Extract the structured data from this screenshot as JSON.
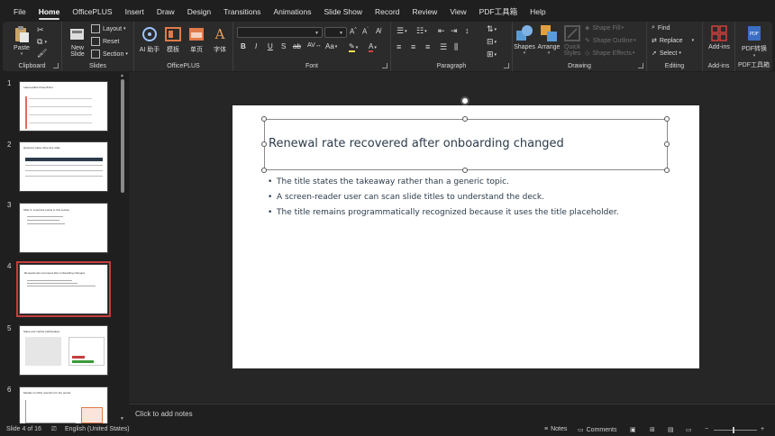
{
  "menu": [
    "File",
    "Home",
    "OfficePLUS",
    "Insert",
    "Draw",
    "Design",
    "Transitions",
    "Animations",
    "Slide Show",
    "Record",
    "Review",
    "View",
    "PDF工具箱",
    "Help"
  ],
  "menu_active": "Home",
  "ribbon": {
    "clipboard": {
      "label": "Clipboard",
      "paste": "Paste"
    },
    "slides": {
      "label": "Slides",
      "new_slide_line1": "New",
      "new_slide_line2": "Slide",
      "layout": "Layout",
      "reset": "Reset",
      "section": "Section"
    },
    "officeplus": {
      "label": "OfficePLUS",
      "ai": "AI 助手",
      "template": "模板",
      "single_page": "单页",
      "font": "字体"
    },
    "font": {
      "label": "Font",
      "bold": "B",
      "italic": "I",
      "underline": "U",
      "strike": "S",
      "ab": "ab",
      "aa": "Aa"
    },
    "paragraph": {
      "label": "Paragraph"
    },
    "drawing": {
      "label": "Drawing",
      "shapes": "Shapes",
      "arrange": "Arrange",
      "quick_styles_line1": "Quick",
      "quick_styles_line2": "Styles",
      "shape_fill": "Shape Fill",
      "shape_outline": "Shape Outline",
      "shape_effects": "Shape Effects"
    },
    "editing": {
      "label": "Editing",
      "find": "Find",
      "replace": "Replace",
      "select": "Select"
    },
    "addins": {
      "label": "Add-ins",
      "button": "Add-ins"
    },
    "pdf": {
      "label": "PDF工具箱",
      "button": "PDF转换"
    }
  },
  "thumbnails": [
    {
      "num": "1",
      "title": "Inaccessible PowerPoint"
    },
    {
      "num": "2",
      "title": "Quarterly sales three-line table"
    },
    {
      "num": "3",
      "title": "Slide 3: important points in this section"
    },
    {
      "num": "4",
      "title": "Renewal rate recovered after onboarding changed"
    },
    {
      "num": "5",
      "title": "Sales and market participation"
    },
    {
      "num": "6",
      "title": "Median monthly retention for the period"
    }
  ],
  "selected_thumbnail": "4",
  "slide": {
    "title": "Renewal rate recovered after onboarding changed",
    "bullets": [
      "The title states the takeaway rather than a generic topic.",
      "A screen-reader user can scan slide titles to understand the deck.",
      "The title remains programmatically recognized because it uses the title placeholder."
    ]
  },
  "notes_placeholder": "Click to add notes",
  "status": {
    "slide_info": "Slide 4 of 16",
    "language": "English (United States)",
    "notes": "Notes",
    "comments": "Comments"
  },
  "colors": {
    "accent": "#c43e3e",
    "title_text": "#2c3b4a",
    "background": "#1f1f1f"
  }
}
